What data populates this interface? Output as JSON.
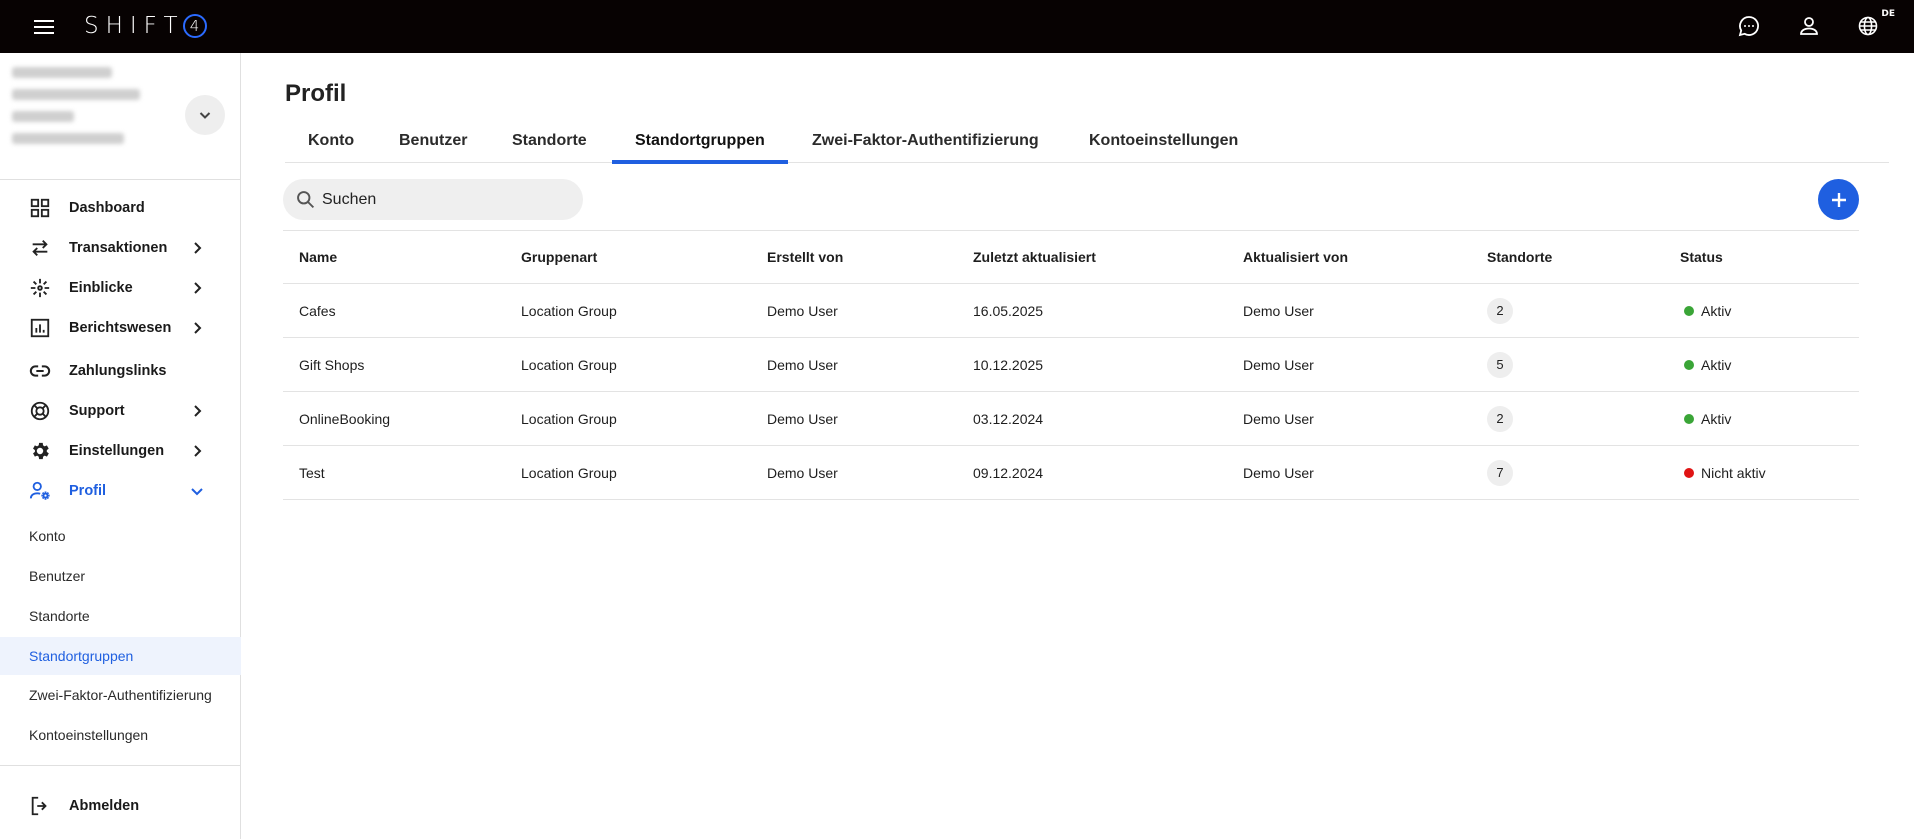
{
  "app": {
    "logo_text": "SHIFT",
    "logo_mark": "4",
    "language": "DE"
  },
  "colors": {
    "topbar": "#070202",
    "accent": "#1f5fe0",
    "active": "#3aa537",
    "inactive": "#e01414"
  },
  "sidebar": {
    "nav": [
      {
        "label": "Dashboard",
        "icon": "dashboard-icon",
        "has_chevron": false
      },
      {
        "label": "Transaktionen",
        "icon": "transactions-icon",
        "has_chevron": true
      },
      {
        "label": "Einblicke",
        "icon": "insights-icon",
        "has_chevron": true
      },
      {
        "label": "Berichtswesen",
        "icon": "reports-icon",
        "has_chevron": true
      },
      {
        "label": "Zahlungslinks",
        "icon": "link-icon",
        "has_chevron": false
      },
      {
        "label": "Support",
        "icon": "support-icon",
        "has_chevron": true
      },
      {
        "label": "Einstellungen",
        "icon": "gear-icon",
        "has_chevron": true
      },
      {
        "label": "Profil",
        "icon": "profile-settings-icon",
        "has_chevron": true,
        "expanded": true
      }
    ],
    "profile_sub": [
      "Konto",
      "Benutzer",
      "Standorte",
      "Standortgruppen",
      "Zwei-Faktor-Authentifizierung",
      "Kontoeinstellungen"
    ],
    "selected_sub": "Standortgruppen",
    "logout_label": "Abmelden"
  },
  "main": {
    "title": "Profil",
    "tabs": [
      "Konto",
      "Benutzer",
      "Standorte",
      "Standortgruppen",
      "Zwei-Faktor-Authentifizierung",
      "Kontoeinstellungen"
    ],
    "active_tab": "Standortgruppen",
    "search": {
      "placeholder": "Suchen"
    },
    "table": {
      "columns": [
        "Name",
        "Gruppenart",
        "Erstellt von",
        "Zuletzt aktualisiert",
        "Aktualisiert von",
        "Standorte",
        "Status"
      ],
      "rows": [
        {
          "name": "Cafes",
          "type": "Location Group",
          "created_by": "Demo User",
          "updated": "16.05.2025",
          "updated_by": "Demo User",
          "locations": "2",
          "status": "Aktiv",
          "active": true
        },
        {
          "name": "Gift Shops",
          "type": "Location Group",
          "created_by": "Demo User",
          "updated": "10.12.2025",
          "updated_by": "Demo User",
          "locations": "5",
          "status": "Aktiv",
          "active": true
        },
        {
          "name": "OnlineBooking",
          "type": "Location Group",
          "created_by": "Demo User",
          "updated": "03.12.2024",
          "updated_by": "Demo User",
          "locations": "2",
          "status": "Aktiv",
          "active": true
        },
        {
          "name": "Test",
          "type": "Location Group",
          "created_by": "Demo User",
          "updated": "09.12.2024",
          "updated_by": "Demo User",
          "locations": "7",
          "status": "Nicht aktiv",
          "active": false
        }
      ]
    }
  }
}
